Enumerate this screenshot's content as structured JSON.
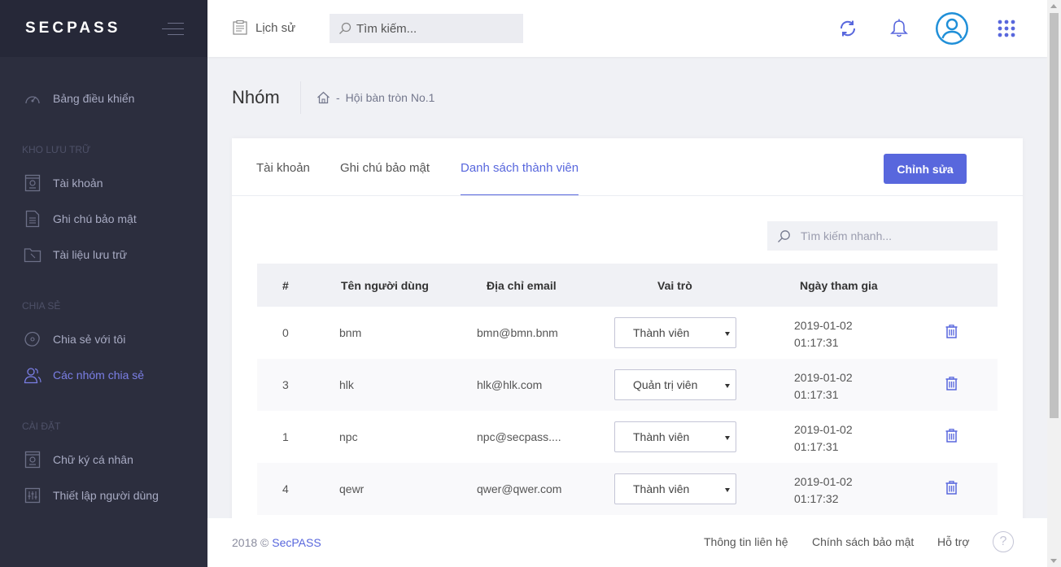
{
  "brand": {
    "logo": "SECPASS"
  },
  "sidebar": {
    "dashboard": "Bảng điều khiển",
    "sections": {
      "storage": "KHO LƯU TRỮ",
      "share": "CHIA SẺ",
      "settings": "CÀI ĐẶT"
    },
    "items": {
      "accounts": "Tài khoản",
      "secure_notes": "Ghi chú bảo mật",
      "documents": "Tài liệu lưu trữ",
      "shared_with_me": "Chia sẻ với tôi",
      "share_groups": "Các nhóm chia sẻ",
      "signature": "Chữ ký cá nhân",
      "user_settings": "Thiết lập người dùng"
    },
    "active_item": "share_groups"
  },
  "topbar": {
    "history_label": "Lịch sử",
    "search_placeholder": "Tìm kiếm...",
    "icons": [
      "refresh-icon",
      "bell-icon",
      "user-avatar-icon",
      "apps-grid-icon"
    ]
  },
  "page": {
    "title": "Nhóm",
    "breadcrumb": {
      "home_icon": "home-icon",
      "separator": "-",
      "current": "Hội bàn tròn No.1"
    }
  },
  "card": {
    "tabs": [
      "Tài khoản",
      "Ghi chú bảo mật",
      "Danh sách thành viên"
    ],
    "active_tab": 2,
    "edit_button": "Chỉnh sửa",
    "quick_search_placeholder": "Tìm kiếm nhanh...",
    "table": {
      "headers": [
        "#",
        "Tên người dùng",
        "Địa chỉ email",
        "Vai trò",
        "Ngày tham gia"
      ],
      "rows": [
        {
          "id": "0",
          "username": "bnm",
          "email": "bmn@bmn.bnm",
          "role": "Thành viên",
          "date": "2019-01-02",
          "time": "01:17:31"
        },
        {
          "id": "3",
          "username": "hlk",
          "email": "hlk@hlk.com",
          "role": "Quản trị viên",
          "date": "2019-01-02",
          "time": "01:17:31"
        },
        {
          "id": "1",
          "username": "npc",
          "email": "npc@secpass....",
          "role": "Thành viên",
          "date": "2019-01-02",
          "time": "01:17:31"
        },
        {
          "id": "4",
          "username": "qewr",
          "email": "qwer@qwer.com",
          "role": "Thành viên",
          "date": "2019-01-02",
          "time": "01:17:32"
        }
      ]
    }
  },
  "footer": {
    "copyright_prefix": "2018 ©",
    "brand": "SecPASS",
    "links": [
      "Thông tin liên hệ",
      "Chính sách bảo mật",
      "Hỗ trợ"
    ],
    "help_symbol": "?"
  },
  "colors": {
    "sidebar_bg": "#2c2e3e",
    "accent": "#5867dd",
    "active_sidebar": "#7b7fe6",
    "avatar": "#1f8fd8"
  }
}
